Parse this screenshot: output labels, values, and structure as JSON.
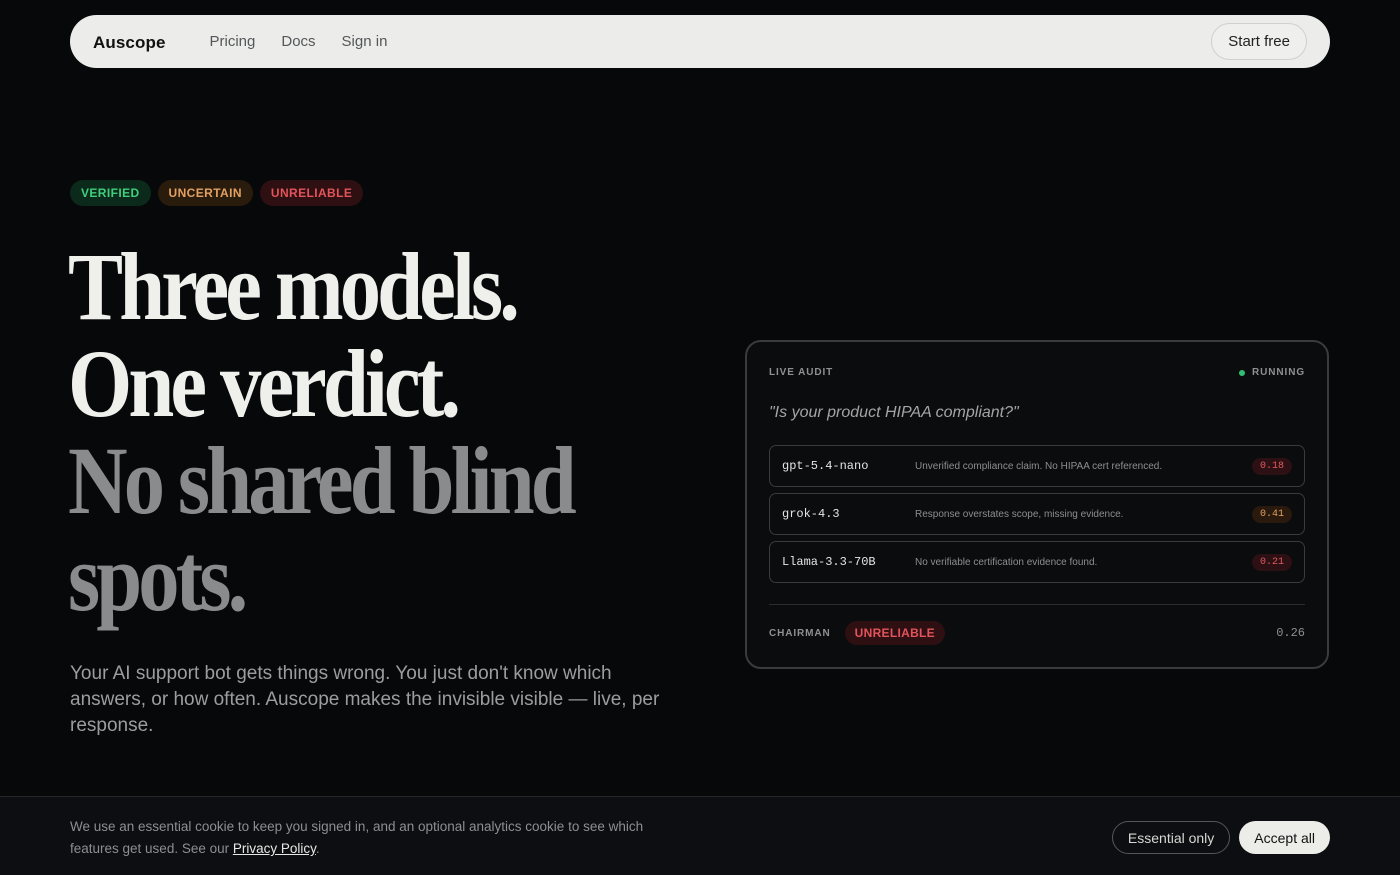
{
  "nav": {
    "brand": "Auscope",
    "links": [
      "Pricing",
      "Docs",
      "Sign in"
    ],
    "cta": "Start free"
  },
  "badges": [
    "VERIFIED",
    "UNCERTAIN",
    "UNRELIABLE"
  ],
  "headline": {
    "line1": "Three models.",
    "line2": "One verdict.",
    "line3": "No shared blind",
    "line4": "spots."
  },
  "subcopy": "Your AI support bot gets things wrong. You just don't know which answers, or how often. Auscope makes the invisible visible — live, per response.",
  "audit": {
    "label": "LIVE AUDIT",
    "status": "RUNNING",
    "question": "\"Is your product HIPAA compliant?\"",
    "rows": [
      {
        "model": "gpt-5.4-nano",
        "note": "Unverified compliance claim. No HIPAA cert referenced.",
        "score": "0.18"
      },
      {
        "model": "grok-4.3",
        "note": "Response overstates scope, missing evidence.",
        "score": "0.41"
      },
      {
        "model": "Llama-3.3-70B",
        "note": "No verifiable certification evidence found.",
        "score": "0.21"
      }
    ],
    "chairman_label": "CHAIRMAN",
    "verdict": "UNRELIABLE",
    "final_score": "0.26"
  },
  "cookie": {
    "text": "We use an essential cookie to keep you signed in, and an optional analytics cookie to see which features get used. See our ",
    "link": "Privacy Policy",
    "suffix": ".",
    "essential": "Essential only",
    "accept": "Accept all"
  },
  "colors": {
    "background": "#07080a",
    "verified": "#3fcf7c",
    "uncertain": "#e3a062",
    "unreliable": "#e2545b",
    "running": "#2fbf73"
  }
}
